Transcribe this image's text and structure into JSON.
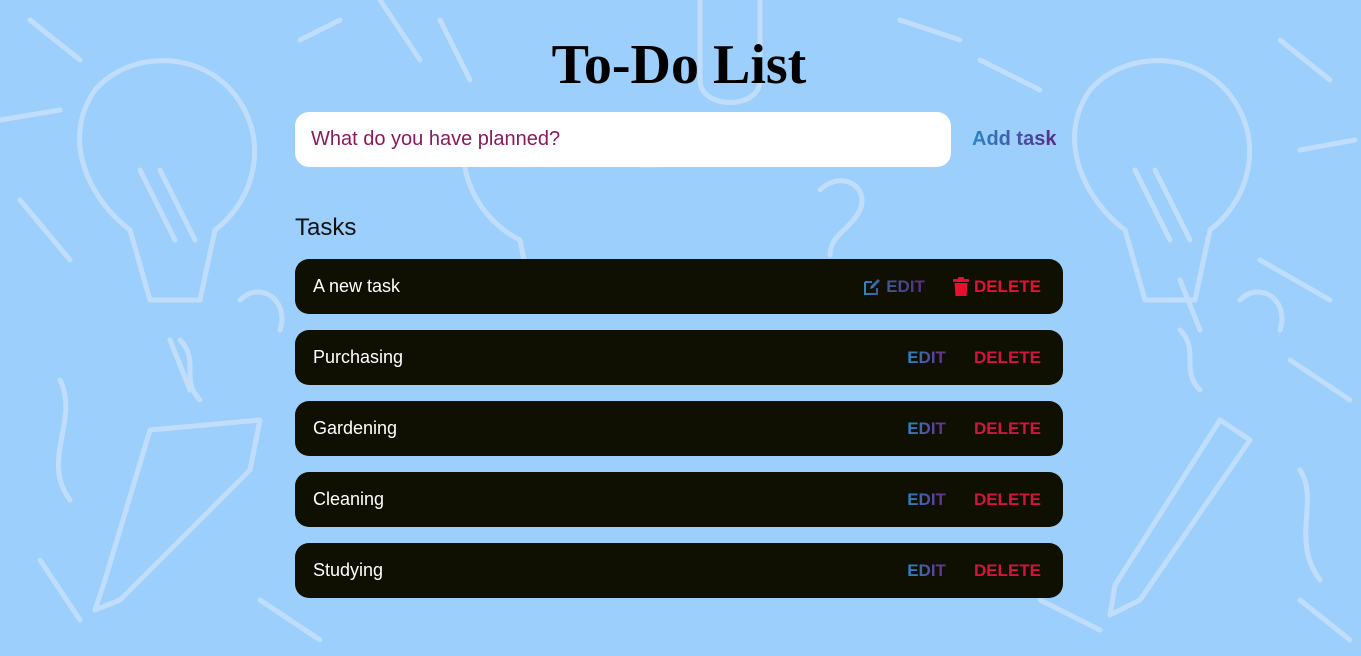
{
  "header": {
    "title": "To-Do List"
  },
  "form": {
    "input_placeholder": "What do you have planned?",
    "add_button_label": "Add task"
  },
  "tasks_section": {
    "heading": "Tasks",
    "items": [
      {
        "text": "A new task",
        "edit_label": "EDIT",
        "delete_label": "DELETE",
        "hovered": true
      },
      {
        "text": "Purchasing",
        "edit_label": "EDIT",
        "delete_label": "DELETE",
        "hovered": false
      },
      {
        "text": "Gardening",
        "edit_label": "EDIT",
        "delete_label": "DELETE",
        "hovered": false
      },
      {
        "text": "Cleaning",
        "edit_label": "EDIT",
        "delete_label": "DELETE",
        "hovered": false
      },
      {
        "text": "Studying",
        "edit_label": "EDIT",
        "delete_label": "DELETE",
        "hovered": false
      }
    ]
  },
  "icons": {
    "edit": "edit-icon",
    "delete": "trash-icon"
  },
  "colors": {
    "background": "#9ccffb",
    "task_row": "#0f0f02",
    "delete": "#d3143c",
    "edit_gradient_start": "#2b86c5",
    "edit_gradient_end": "#6b2a8a",
    "placeholder": "#8a1a5c"
  }
}
